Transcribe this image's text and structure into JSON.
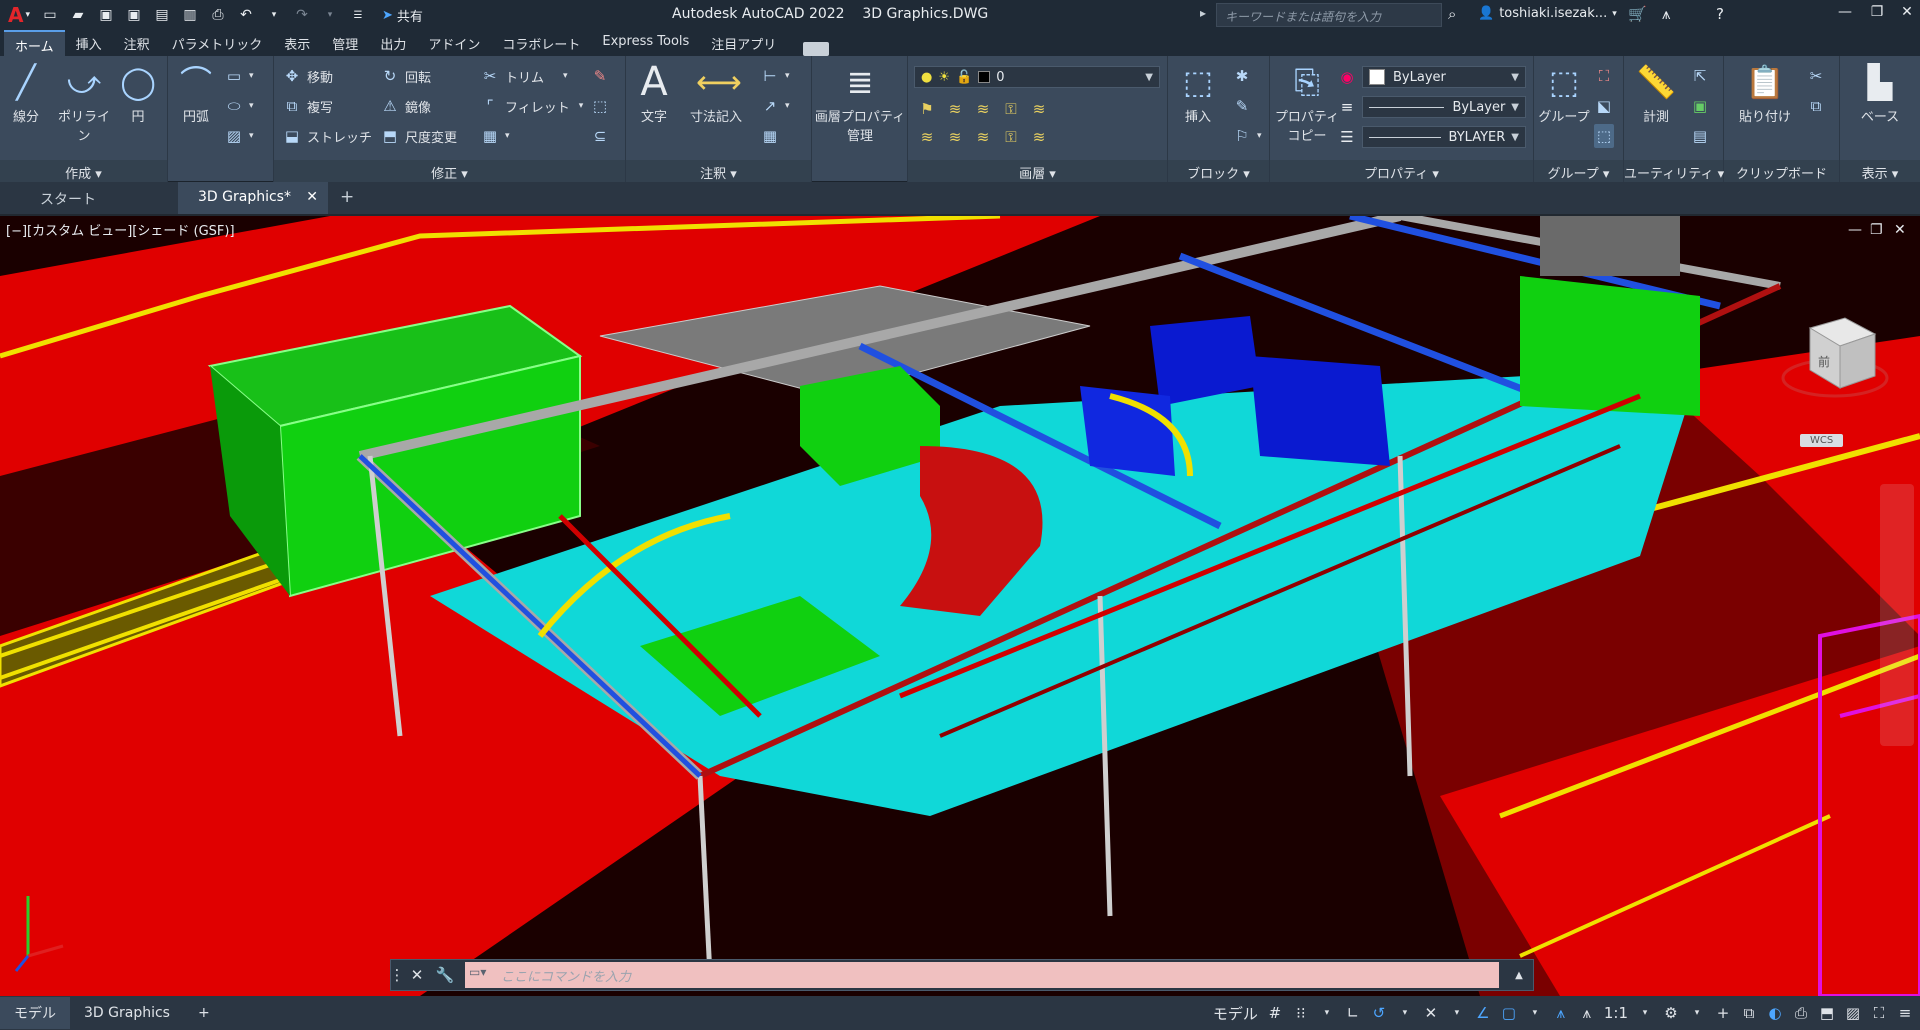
{
  "titlebar": {
    "app_title": "Autodesk AutoCAD 2022",
    "file_name": "3D Graphics.DWG",
    "share_label": "共有",
    "search_placeholder": "キーワードまたは語句を入力",
    "user_name": "toshiaki.isezak..."
  },
  "ribbon_tabs": [
    "ホーム",
    "挿入",
    "注釈",
    "パラメトリック",
    "表示",
    "管理",
    "出力",
    "アドイン",
    "コラボレート",
    "Express Tools",
    "注目アプリ"
  ],
  "panels": {
    "draw": {
      "label": "作成",
      "line": "線分",
      "polyline": "ポリライン",
      "circle": "円",
      "arc": "円弧"
    },
    "modify": {
      "label": "修正",
      "move": "移動",
      "rotate": "回転",
      "trim": "トリム",
      "copy": "複写",
      "mirror": "鏡像",
      "fillet": "フィレット",
      "stretch": "ストレッチ",
      "scale": "尺度変更"
    },
    "annotation": {
      "label": "注釈",
      "text": "文字",
      "dimension": "寸法記入"
    },
    "layer_props": {
      "line1": "画層プロパティ",
      "line2": "管理"
    },
    "layers": {
      "label": "画層",
      "current_layer": "0"
    },
    "block": {
      "label": "ブロック",
      "insert": "挿入"
    },
    "properties": {
      "label": "プロパティ",
      "match_line1": "プロパティ",
      "match_line2": "コピー",
      "color": "ByLayer",
      "linetype": "ByLayer",
      "lineweight": "BYLAYER"
    },
    "groups": {
      "label": "グループ",
      "group": "グループ"
    },
    "utilities": {
      "label": "ユーティリティ",
      "measure": "計測"
    },
    "clipboard": {
      "label": "クリップボード",
      "paste": "貼り付け"
    },
    "view": {
      "label": "表示",
      "base": "ベース"
    }
  },
  "file_tabs": {
    "start": "スタート",
    "active": "3D Graphics*"
  },
  "viewport": {
    "label": "[−][カスタム ビュー][シェード (GSF)]",
    "wcs": "WCS",
    "cube_face": "前"
  },
  "command_line": {
    "placeholder": "ここにコマンドを入力"
  },
  "status_bar": {
    "model_tab": "モデル",
    "layout_tab": "3D Graphics",
    "model_label": "モデル",
    "scale": "1:1"
  },
  "colors": {
    "floor_red": "#e00000",
    "equipment_green": "#10d010",
    "equipment_blue": "#0a1ad0",
    "cyan_floor": "#10d8d8",
    "steel_gray": "#9a9a9a",
    "yellow": "#f0e000",
    "magenta": "#e010e0"
  }
}
